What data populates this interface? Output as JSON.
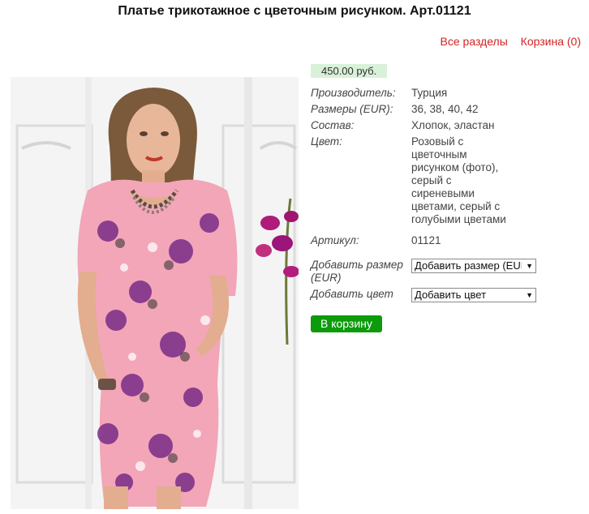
{
  "page": {
    "title": "Платье трикотажное с цветочным рисунком. Арт.01121"
  },
  "nav": {
    "all_sections": "Все разделы",
    "cart": "Корзина (0)"
  },
  "product": {
    "price": "450.00 руб.",
    "specs": [
      {
        "label": "Производитель:",
        "value": "Турция"
      },
      {
        "label": "Размеры (EUR):",
        "value": "36, 38, 40, 42"
      },
      {
        "label": "Состав:",
        "value": "Хлопок, эластан"
      },
      {
        "label": "Цвет:",
        "value": "Розовый с цветочным рисунком (фото), серый с сиреневыми цветами, серый с голубыми цветами"
      },
      {
        "label": "Артикул:",
        "value": "01121"
      }
    ],
    "add_size": {
      "label": "Добавить размер (EUR)",
      "selected": "Добавить размер (EUR)"
    },
    "add_color": {
      "label": "Добавить цвет",
      "selected": "Добавить цвет"
    },
    "to_cart": "В корзину"
  },
  "colors": {
    "link": "#d32323",
    "price_bg": "#d9f1d9",
    "button": "#0b9b0b",
    "dress": "#f2a6b8",
    "flowers": "#7a2b87"
  }
}
